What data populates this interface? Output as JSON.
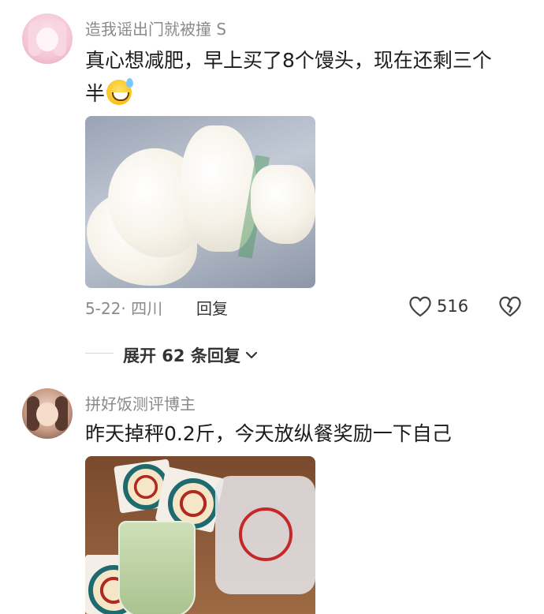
{
  "comments": [
    {
      "username": "造我谣出门就被撞 S",
      "text_line1": "真心想减肥，早上买了8个馒头，现在还剩三个",
      "text_line2": "半",
      "date_location": "5-22· 四川",
      "reply_label": "回复",
      "likes": "516",
      "expand_replies": "展开 62 条回复"
    },
    {
      "username": "拼好饭测评博主",
      "text_line1": "昨天掉秤0.2斤，今天放纵餐奖励一下自己"
    }
  ],
  "icons": {
    "like": "heart-outline-icon",
    "dislike": "broken-heart-icon",
    "expand": "chevron-down-icon",
    "emoji": "grinning-sweat-emoji"
  },
  "colors": {
    "username": "#8a8a8a",
    "text": "#1c1c1c",
    "meta": "#8a8a8a"
  }
}
